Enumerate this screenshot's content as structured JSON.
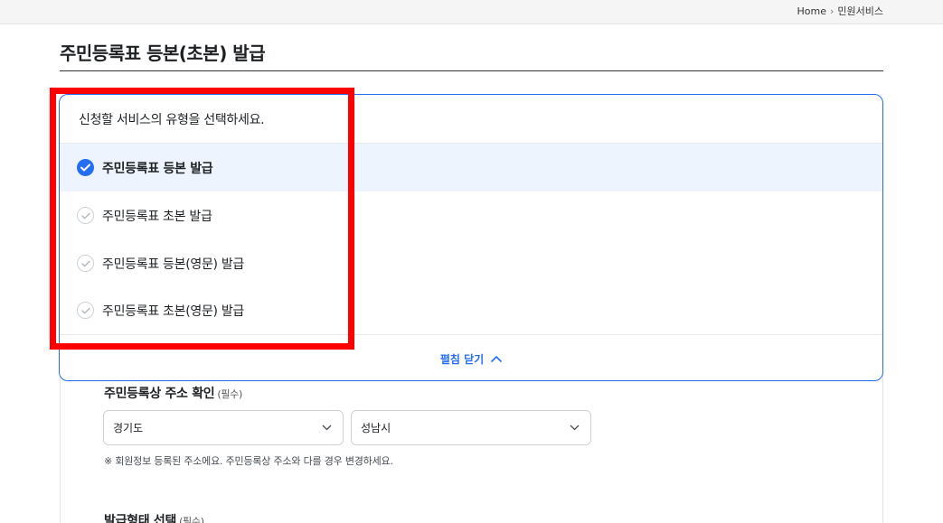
{
  "breadcrumb": {
    "home": "Home",
    "current": "민원서비스"
  },
  "page": {
    "title": "주민등록표 등본(초본) 발급"
  },
  "service_panel": {
    "prompt": "신청할 서비스의 유형을 선택하세요.",
    "options": [
      {
        "label": "주민등록표 등본 발급",
        "selected": true
      },
      {
        "label": "주민등록표 초본 발급",
        "selected": false
      },
      {
        "label": "주민등록표 등본(영문) 발급",
        "selected": false
      },
      {
        "label": "주민등록표 초본(영문) 발급",
        "selected": false
      }
    ],
    "toggle_label": "펼침 닫기"
  },
  "address": {
    "title": "주민등록상 주소 확인",
    "required": "(필수)",
    "province": "경기도",
    "city": "성남시",
    "note": "※ 회원정보 등록된 주소에요. 주민등록상 주소와 다를 경우 변경하세요."
  },
  "issue_type": {
    "title": "발급형태 선택",
    "required": "(필수)"
  },
  "colors": {
    "accent": "#256ef4",
    "selected_bg": "#eef4fe",
    "highlight": "#ff0000"
  }
}
